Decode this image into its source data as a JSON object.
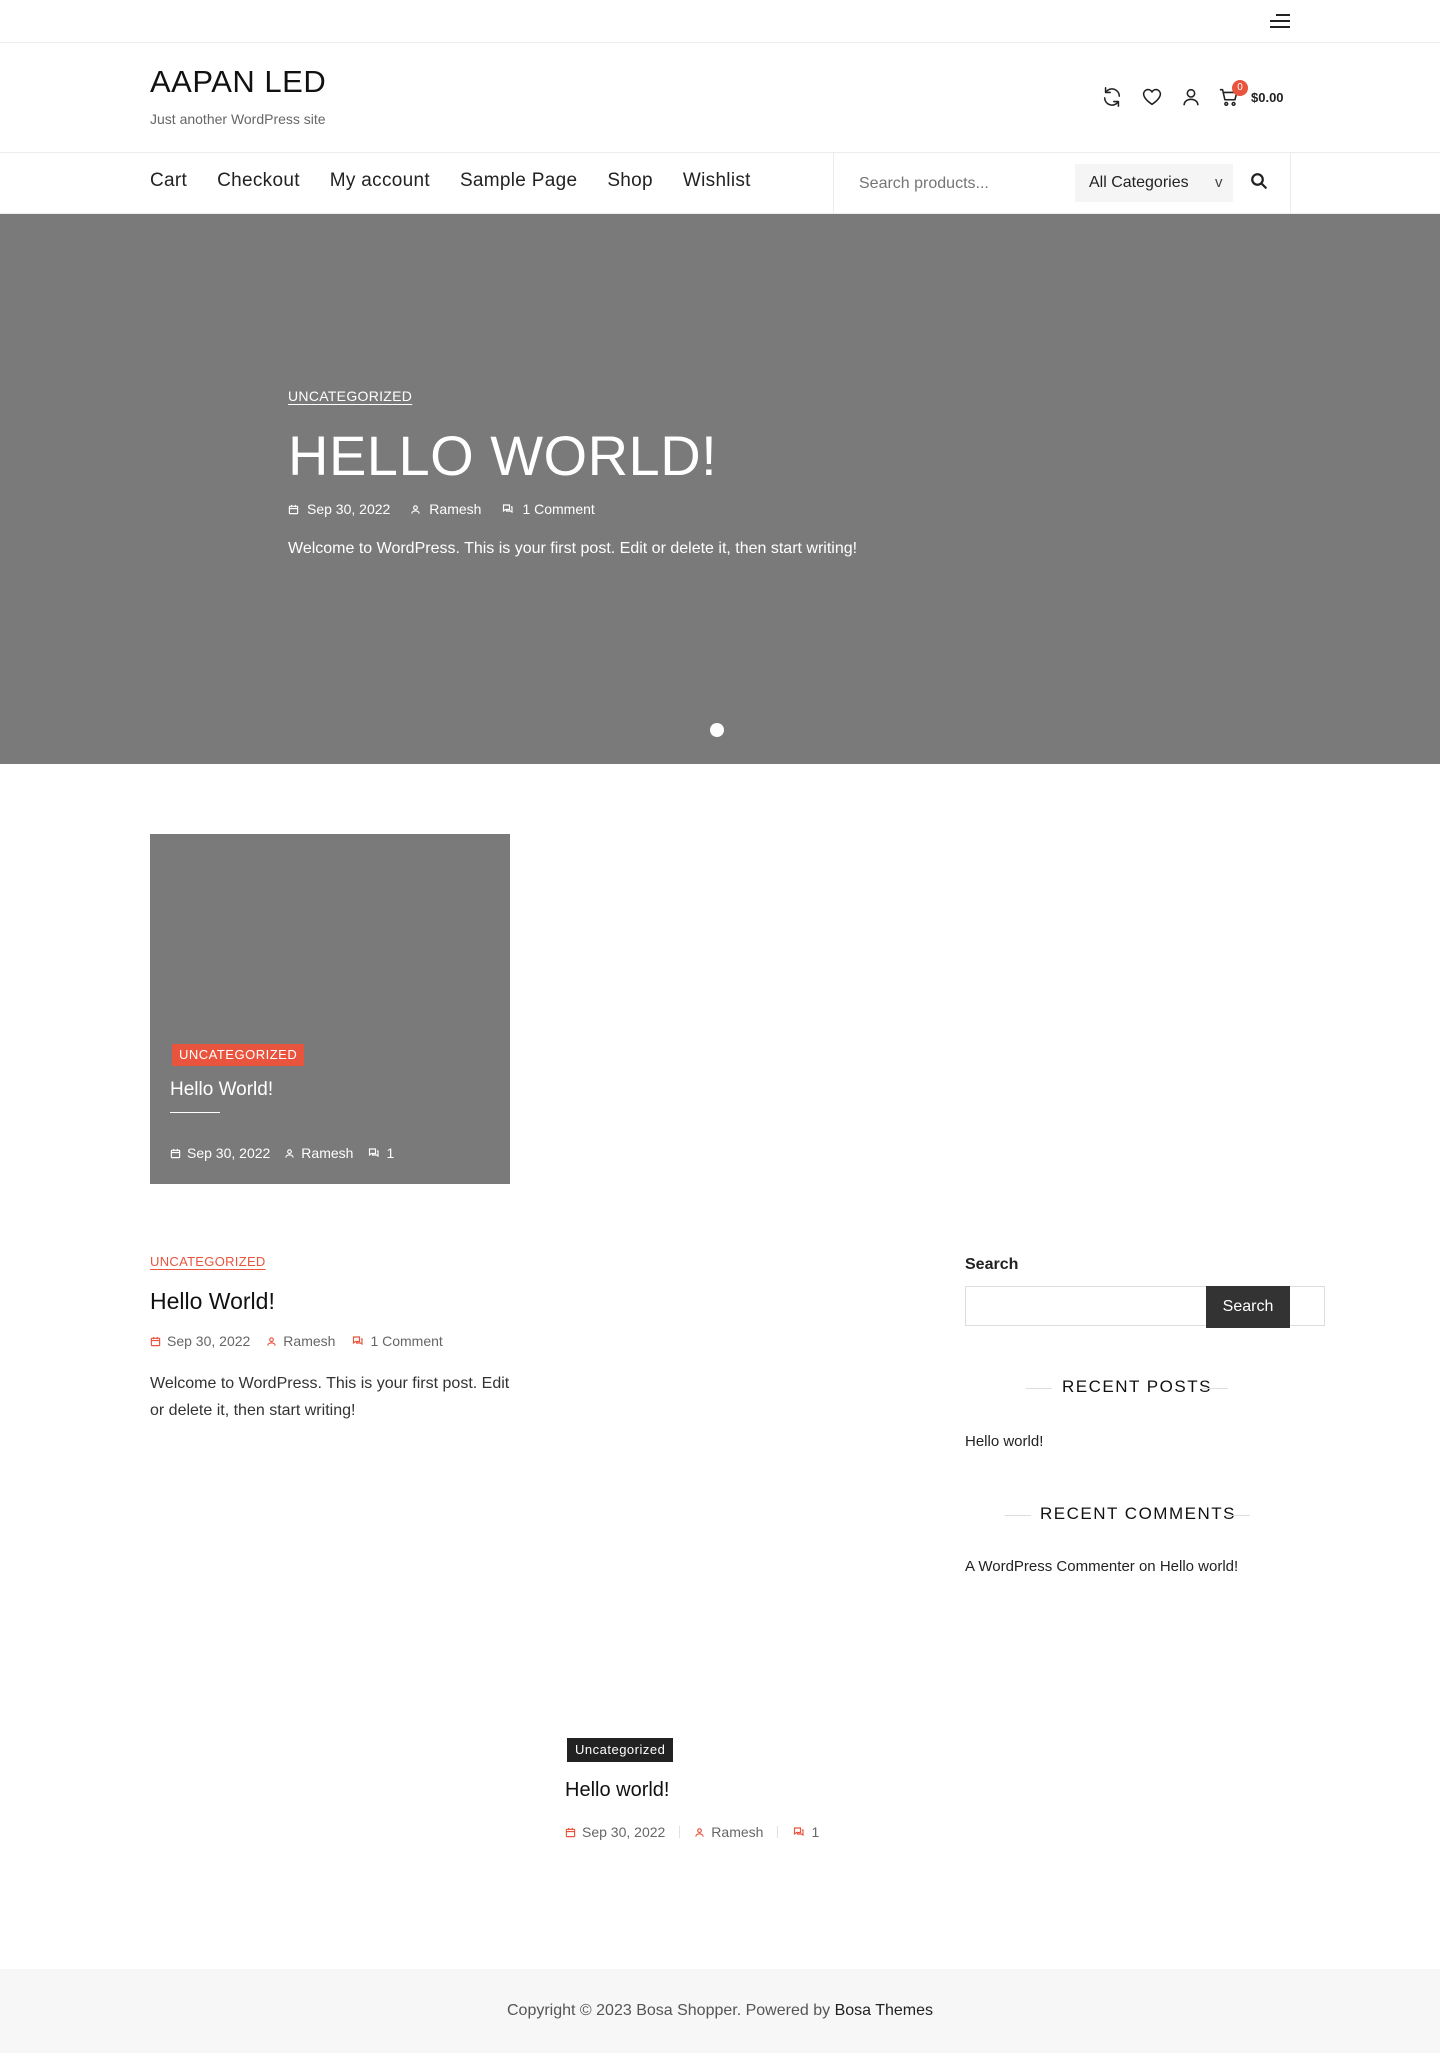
{
  "site": {
    "title": "AAPAN LED",
    "tagline": "Just another WordPress site"
  },
  "header": {
    "cart_count": "0",
    "cart_total": "$0.00",
    "icons": [
      "refresh-icon",
      "heart-icon",
      "user-icon",
      "cart-icon",
      "menu-icon"
    ]
  },
  "nav": {
    "items": [
      {
        "label": "Cart"
      },
      {
        "label": "Checkout"
      },
      {
        "label": "My account"
      },
      {
        "label": "Sample Page"
      },
      {
        "label": "Shop"
      },
      {
        "label": "Wishlist"
      }
    ]
  },
  "search": {
    "placeholder": "Search products...",
    "category": "All Categories",
    "arrow": "v"
  },
  "hero": {
    "category": "UNCATEGORIZED",
    "title": "HELLO WORLD!",
    "date": "Sep 30, 2022",
    "author": "Ramesh",
    "comments": "1 Comment",
    "excerpt": "Welcome to WordPress. This is your first post. Edit or delete it, then start writing!"
  },
  "card": {
    "category": "UNCATEGORIZED",
    "title": "Hello World!",
    "date": "Sep 30, 2022",
    "author": "Ramesh",
    "comments": "1"
  },
  "post": {
    "category": "UNCATEGORIZED",
    "title": "Hello World!",
    "date": "Sep 30, 2022",
    "author": "Ramesh",
    "comments": "1 Comment",
    "excerpt": "Welcome to WordPress. This is your first post. Edit or delete it, then start writing!"
  },
  "sidebar": {
    "search_label": "Search",
    "search_button": "Search",
    "recent_posts_heading": "RECENT POSTS",
    "recent_posts": [
      "Hello world!"
    ],
    "recent_comments_heading": "RECENT COMMENTS",
    "comment_author": "A WordPress Commenter",
    "comment_on": "on",
    "comment_post": "Hello world!"
  },
  "bottom_post": {
    "category": "Uncategorized",
    "title": "Hello world!",
    "date": "Sep 30, 2022",
    "author": "Ramesh",
    "comments": "1"
  },
  "footer": {
    "copyright": "Copyright © 2023 Bosa Shopper. Powered by",
    "brand": "Bosa Themes"
  },
  "colors": {
    "accent": "#e8543d",
    "hero_bg": "#7a7a7a",
    "dark": "#222222",
    "footer_bg": "#f7f7f7"
  }
}
